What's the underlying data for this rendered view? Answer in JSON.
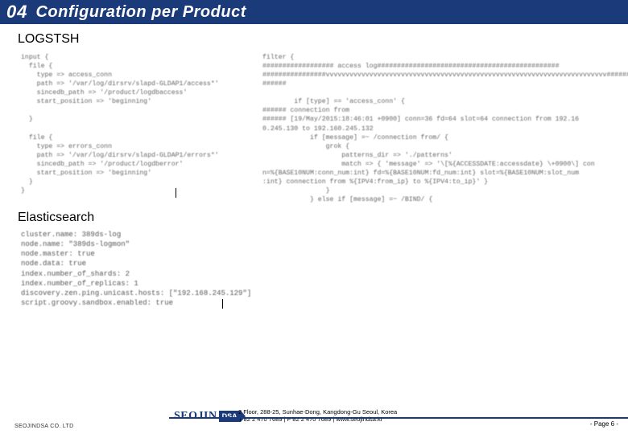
{
  "header": {
    "number": "04",
    "title": "Configuration per Product"
  },
  "section1": {
    "label": "LOGSTSH",
    "code_left": "input {\n  file {\n    type => access_conn\n    path => '/var/log/dirsrv/slapd-GLDAP1/access*'\n    sincedb_path => '/product/logdbaccess'\n    start_position => 'beginning'\n\n  }\n\n  file {\n    type => errors_conn\n    path => '/var/log/dirsrv/slapd-GLDAP1/errors*'\n    sincedb_path => '/product/logdberror'\n    start_position => 'beginning'\n  }\n}",
    "code_right": "filter {\n################## access log##############################################\n################vvvvvvvvvvvvvvvvvvvvvvvvvvvvvvvvvvvvvvvvvvvvvvvvvvvvvvvvvvvvvvvvvvvvvvv######\n######\n\n        if [type] == 'access_conn' {\n###### connection from\n###### [19/May/2015:18:46:01 +0900] conn=36 fd=64 slot=64 connection from 192.16\n0.245.130 to 192.160.245.132\n            if [message] =~ /connection from/ {\n                grok {\n                    patterns_dir => './patterns'\n                    match => { 'message' => '\\[%{ACCESSDATE:accessdate} \\+0900\\] con\nn=%{BASE10NUM:conn_num:int} fd=%{BASE10NUM:fd_num:int} slot=%{BASE10NUM:slot_num\n:int} connection from %{IPV4:from_ip} to %{IPV4:to_ip}' }\n                }\n            } else if [message] =~ /BIND/ {"
  },
  "section2": {
    "label": "Elasticsearch",
    "code": "cluster.name: 389ds-log\nnode.name: \"389ds-logmon\"\nnode.master: true\nnode.data: true\nindex.number_of_shards: 2\nindex.number_of_replicas: 1\ndiscovery.zen.ping.unicast.hosts: [\"192.168.245.129\"]\nscript.groovy.sandbox.enabled: true"
  },
  "footer": {
    "company": "SEOJINDSA CO. LTD",
    "logo_main": "SEOJIN",
    "logo_sub": "DSA",
    "address": "2 Floor, 288-25, Sunhae-Dong, Kangdong-Gu Seoul, Korea",
    "phone": "T 82 2 470 7689 | F 82 2 470 7689 | www.seojindsa.kr",
    "page": "- Page 6 -"
  }
}
